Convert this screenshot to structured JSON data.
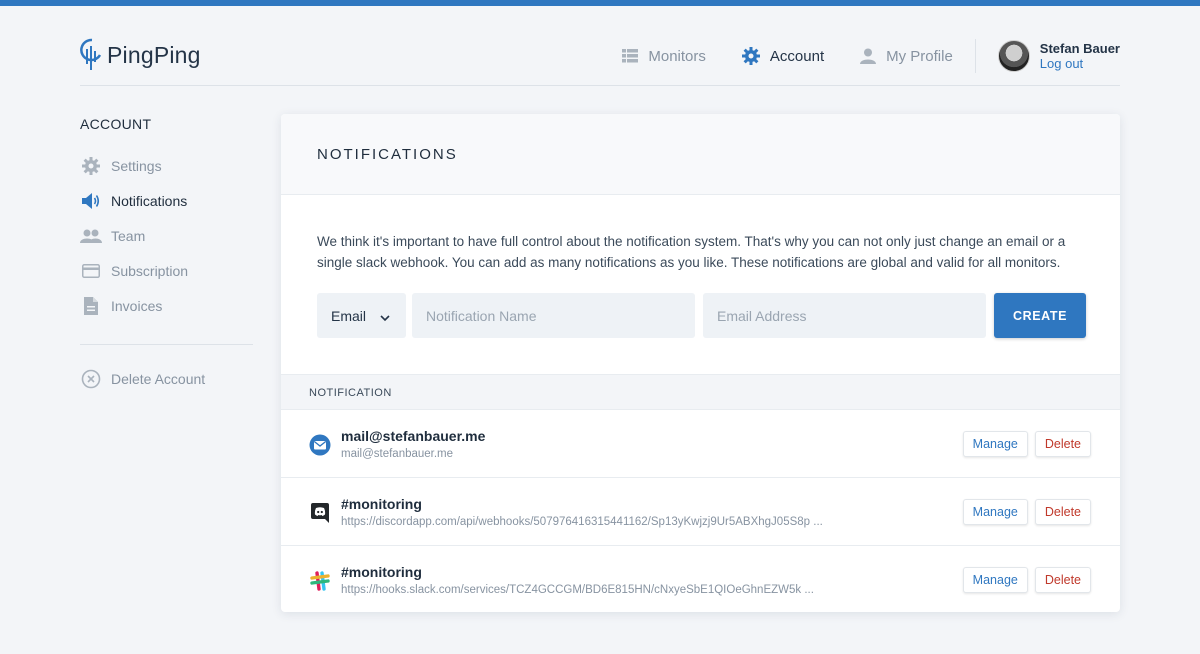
{
  "brand": {
    "name": "PingPing"
  },
  "nav": {
    "items": [
      {
        "label": "Monitors",
        "icon": "list-icon"
      },
      {
        "label": "Account",
        "icon": "gear-icon"
      },
      {
        "label": "My Profile",
        "icon": "user-icon"
      }
    ],
    "user": {
      "name": "Stefan Bauer",
      "logout": "Log out"
    }
  },
  "sidebar": {
    "title": "ACCOUNT",
    "items": [
      {
        "label": "Settings",
        "icon": "gear-icon"
      },
      {
        "label": "Notifications",
        "icon": "speaker-icon"
      },
      {
        "label": "Team",
        "icon": "team-icon"
      },
      {
        "label": "Subscription",
        "icon": "card-icon"
      },
      {
        "label": "Invoices",
        "icon": "document-icon"
      }
    ],
    "delete_account": "Delete Account"
  },
  "main": {
    "title": "NOTIFICATIONS",
    "description": "We think it's important to have full control about the notification system. That's why you can not only just change an email or a single slack webhook. You can add as many notifications as you like. These notifications are global and valid for all monitors.",
    "form": {
      "type_value": "Email",
      "name_placeholder": "Notification Name",
      "email_placeholder": "Email Address",
      "create_label": "CREATE"
    },
    "table_header": "NOTIFICATION",
    "rows": [
      {
        "title": "mail@stefanbauer.me",
        "subtitle": "mail@stefanbauer.me",
        "icon": "email-icon"
      },
      {
        "title": "#monitoring",
        "subtitle": "https://discordapp.com/api/webhooks/507976416315441162/Sp13yKwjzj9Ur5ABXhgJ05S8p ...",
        "icon": "discord-icon"
      },
      {
        "title": "#monitoring",
        "subtitle": "https://hooks.slack.com/services/TCZ4GCCGM/BD6E815HN/cNxyeSbE1QIOeGhnEZW5k ...",
        "icon": "slack-icon"
      }
    ],
    "manage_label": "Manage",
    "delete_label": "Delete"
  },
  "colors": {
    "accent": "#2f77c0",
    "danger": "#c0392b",
    "background": "#f3f5f8"
  }
}
